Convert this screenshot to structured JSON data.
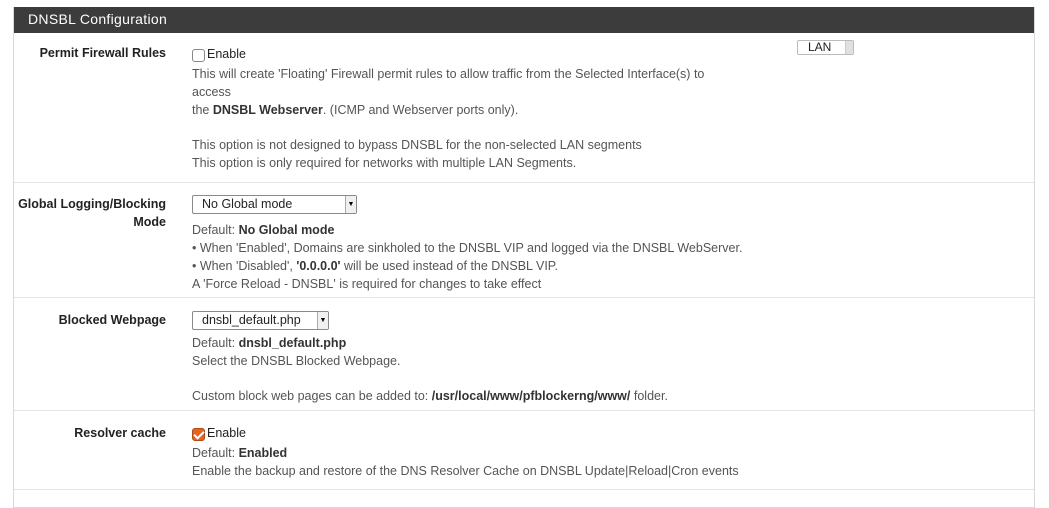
{
  "panel": {
    "title": "DNSBL Configuration"
  },
  "permit_firewall": {
    "label": "Permit Firewall Rules",
    "checkbox_label": "Enable",
    "checked": false,
    "desc1": "This will create 'Floating' Firewall permit rules to allow traffic from the Selected Interface(s) to",
    "desc2": "access",
    "desc3_prefix": "the ",
    "desc3_bold": "DNSBL Webserver",
    "desc3_suffix": ". (ICMP and Webserver ports only).",
    "desc4": "This option is not designed to bypass DNSBL for the non-selected LAN segments",
    "desc5": "This option is only required for networks with multiple LAN Segments.",
    "interface_option": "LAN"
  },
  "global_logging": {
    "label_line1": "Global Logging/Blocking",
    "label_line2": "Mode",
    "selected": "No Global mode",
    "default_prefix": "Default: ",
    "default_value": "No Global mode",
    "desc1": "• When 'Enabled', Domains are sinkholed to the DNSBL VIP and logged via the DNSBL WebServer.",
    "desc2_prefix": "• When 'Disabled', ",
    "desc2_bold": "'0.0.0.0'",
    "desc2_suffix": " will be used instead of the DNSBL VIP.",
    "desc3": "A 'Force Reload - DNSBL' is required for changes to take effect"
  },
  "blocked_webpage": {
    "label": "Blocked Webpage",
    "selected": "dnsbl_default.php",
    "default_prefix": "Default: ",
    "default_value": "dnsbl_default.php",
    "desc1": "Select the DNSBL Blocked Webpage.",
    "desc2_prefix": "Custom block web pages can be added to: ",
    "desc2_bold": "/usr/local/www/pfblockerng/www/",
    "desc2_suffix": " folder."
  },
  "resolver_cache": {
    "label": "Resolver cache",
    "checkbox_label": "Enable",
    "checked": true,
    "default_prefix": "Default: ",
    "default_value": "Enabled",
    "desc1": "Enable the backup and restore of the DNS Resolver Cache on DNSBL Update|Reload|Cron events"
  },
  "colors": {
    "accent": "#e5641f",
    "heading_bg": "#3c3c3c"
  }
}
